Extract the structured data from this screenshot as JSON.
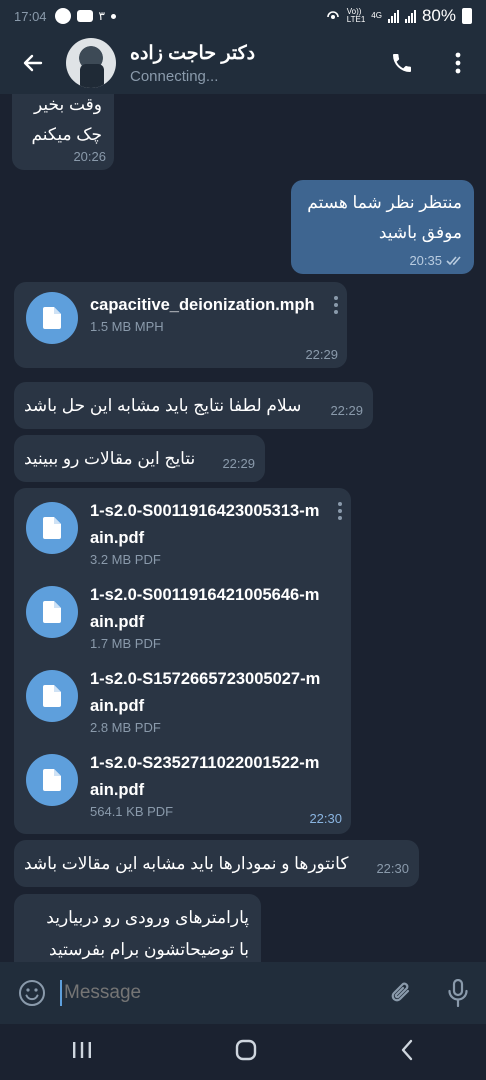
{
  "status_bar": {
    "time": "17:04",
    "notification_count": "۳",
    "network_top": "Vo))",
    "network_bottom": "LTE1",
    "network_type": "4G",
    "battery": "80%"
  },
  "header": {
    "title": "دکتر حاجت زاده",
    "status": "Connecting..."
  },
  "messages": {
    "m1": {
      "line1": "وقت بخیر",
      "line2": "چک میکنم",
      "time": "20:26"
    },
    "m2": {
      "line1": "منتظر نظر شما هستم",
      "line2": "موفق باشید",
      "time": "20:35"
    },
    "m3": {
      "name": "capacitive_deionization.mph",
      "meta": "1.5 MB MPH",
      "time": "22:29"
    },
    "m4": {
      "text": "سلام لطفا نتایج باید مشابه این حل باشد",
      "time": "22:29"
    },
    "m5": {
      "text": "نتایج این مقالات رو ببینید",
      "time": "22:29"
    },
    "m6": {
      "files": [
        {
          "name": "1-s2.0-S0011916423005313-main.pdf",
          "meta": "3.2 MB PDF"
        },
        {
          "name": "1-s2.0-S0011916421005646-main.pdf",
          "meta": "1.7 MB PDF"
        },
        {
          "name": "1-s2.0-S1572665723005027-main.pdf",
          "meta": "2.8 MB PDF"
        },
        {
          "name": "1-s2.0-S2352711022001522-main.pdf",
          "meta": "564.1 KB PDF"
        }
      ],
      "time": "22:30"
    },
    "m7": {
      "text": "کانتورها و نمودارها باید مشابه این مقالات باشد",
      "time": "22:30"
    },
    "m8": {
      "line1": "پارامترهای ورودی رو دربیارید",
      "line2": "با توضیحاتشون برام بفرستید"
    }
  },
  "input": {
    "placeholder": "Message"
  },
  "colors": {
    "accent": "#5e9fdc",
    "outgoing_bubble": "#3e6590",
    "incoming_bubble": "#2a3544",
    "header": "#212d3b"
  },
  "icons": {
    "back": "arrow-left-icon",
    "call": "phone-icon",
    "menu": "more-vertical-icon",
    "file": "document-icon",
    "emoji": "emoji-icon",
    "attach": "paperclip-icon",
    "mic": "microphone-icon",
    "read": "double-check-icon"
  }
}
